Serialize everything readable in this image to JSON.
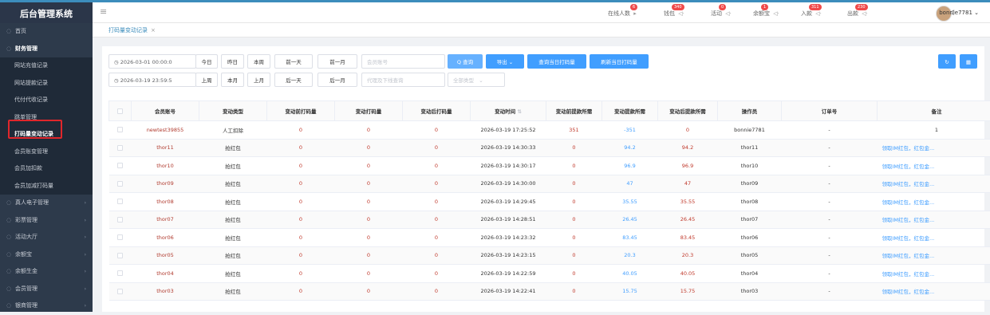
{
  "app": {
    "title": "后台管理系统"
  },
  "sidebar": {
    "items": [
      {
        "label": "首页",
        "icon": "home-icon",
        "type": "top"
      },
      {
        "label": "财务管理",
        "icon": "finance-icon",
        "type": "group-open"
      },
      {
        "label": "网站充值记录",
        "type": "sub"
      },
      {
        "label": "网站提款记录",
        "type": "sub"
      },
      {
        "label": "代付代收记录",
        "type": "sub"
      },
      {
        "label": "跳单管理",
        "type": "sub"
      },
      {
        "label": "打码量变动记录",
        "type": "sub-active"
      },
      {
        "label": "会员账变管理",
        "type": "sub"
      },
      {
        "label": "会员加扣款",
        "type": "sub"
      },
      {
        "label": "会员加减打码量",
        "type": "sub"
      },
      {
        "label": "真人电子管理",
        "icon": "casino-icon",
        "type": "top"
      },
      {
        "label": "彩票管理",
        "icon": "lottery-icon",
        "type": "top"
      },
      {
        "label": "活动大厅",
        "icon": "activity-icon",
        "type": "top"
      },
      {
        "label": "余额宝",
        "icon": "balance-icon",
        "type": "top"
      },
      {
        "label": "余额生金",
        "icon": "gold-icon",
        "type": "top"
      },
      {
        "label": "会员管理",
        "icon": "user-icon",
        "type": "top"
      },
      {
        "label": "银商管理",
        "icon": "merchant-icon",
        "type": "top"
      }
    ]
  },
  "topbar": {
    "items": [
      {
        "label": "在线人数",
        "badge": "6"
      },
      {
        "label": "钱包",
        "badge": "340"
      },
      {
        "label": "活动",
        "badge": "0"
      },
      {
        "label": "余额宝",
        "badge": "1"
      },
      {
        "label": "入款",
        "badge": "311"
      },
      {
        "label": "出款",
        "badge": "230"
      }
    ],
    "username": "bonnie7781"
  },
  "tab": {
    "label": "打码量变动记录"
  },
  "filters": {
    "date_start": "2026-03-01 00:00:0",
    "date_end": "2026-03-19 23:59:5",
    "row1_buttons": [
      "今日",
      "昨日",
      "本周",
      "前一天",
      "前一月"
    ],
    "row2_buttons": [
      "上周",
      "本月",
      "上月",
      "后一天",
      "后一月"
    ],
    "account_placeholder": "会员账号",
    "agent_placeholder": "代理及下线查询",
    "type_select": "全部类型",
    "query": "Q 查询",
    "export": "导出",
    "query_today": "查询当日打码量",
    "refresh_today": "刷新当日打码量"
  },
  "table": {
    "headers": [
      "会员账号",
      "变动类型",
      "变动前打码量",
      "变动打码量",
      "变动后打码量",
      "变动时间",
      "变动前提款所需",
      "变动提款所需",
      "变动后提款所需",
      "操作员",
      "订单号",
      "备注"
    ],
    "rows": [
      [
        "newtest39855",
        "人工扣除",
        "0",
        "0",
        "0",
        "2026-03-19 17:25:52",
        "351",
        "-351",
        "0",
        "bonnie7781",
        "-",
        "1"
      ],
      [
        "thor11",
        "抢红包",
        "0",
        "0",
        "0",
        "2026-03-19 14:30:33",
        "0",
        "94.2",
        "94.2",
        "thor11",
        "-",
        "领取IM红包，红包金..."
      ],
      [
        "thor10",
        "抢红包",
        "0",
        "0",
        "0",
        "2026-03-19 14:30:17",
        "0",
        "96.9",
        "96.9",
        "thor10",
        "-",
        "领取IM红包，红包金..."
      ],
      [
        "thor09",
        "抢红包",
        "0",
        "0",
        "0",
        "2026-03-19 14:30:00",
        "0",
        "47",
        "47",
        "thor09",
        "-",
        "领取IM红包，红包金..."
      ],
      [
        "thor08",
        "抢红包",
        "0",
        "0",
        "0",
        "2026-03-19 14:29:45",
        "0",
        "35.55",
        "35.55",
        "thor08",
        "-",
        "领取IM红包，红包金..."
      ],
      [
        "thor07",
        "抢红包",
        "0",
        "0",
        "0",
        "2026-03-19 14:28:51",
        "0",
        "26.45",
        "26.45",
        "thor07",
        "-",
        "领取IM红包，红包金..."
      ],
      [
        "thor06",
        "抢红包",
        "0",
        "0",
        "0",
        "2026-03-19 14:23:32",
        "0",
        "83.45",
        "83.45",
        "thor06",
        "-",
        "领取IM红包，红包金..."
      ],
      [
        "thor05",
        "抢红包",
        "0",
        "0",
        "0",
        "2026-03-19 14:23:15",
        "0",
        "20.3",
        "20.3",
        "thor05",
        "-",
        "领取IM红包，红包金..."
      ],
      [
        "thor04",
        "抢红包",
        "0",
        "0",
        "0",
        "2026-03-19 14:22:59",
        "0",
        "40.05",
        "40.05",
        "thor04",
        "-",
        "领取IM红包，红包金..."
      ],
      [
        "thor03",
        "抢红包",
        "0",
        "0",
        "0",
        "2026-03-19 14:22:41",
        "0",
        "15.75",
        "15.75",
        "thor03",
        "-",
        "领取IM红包，红包金..."
      ]
    ]
  }
}
